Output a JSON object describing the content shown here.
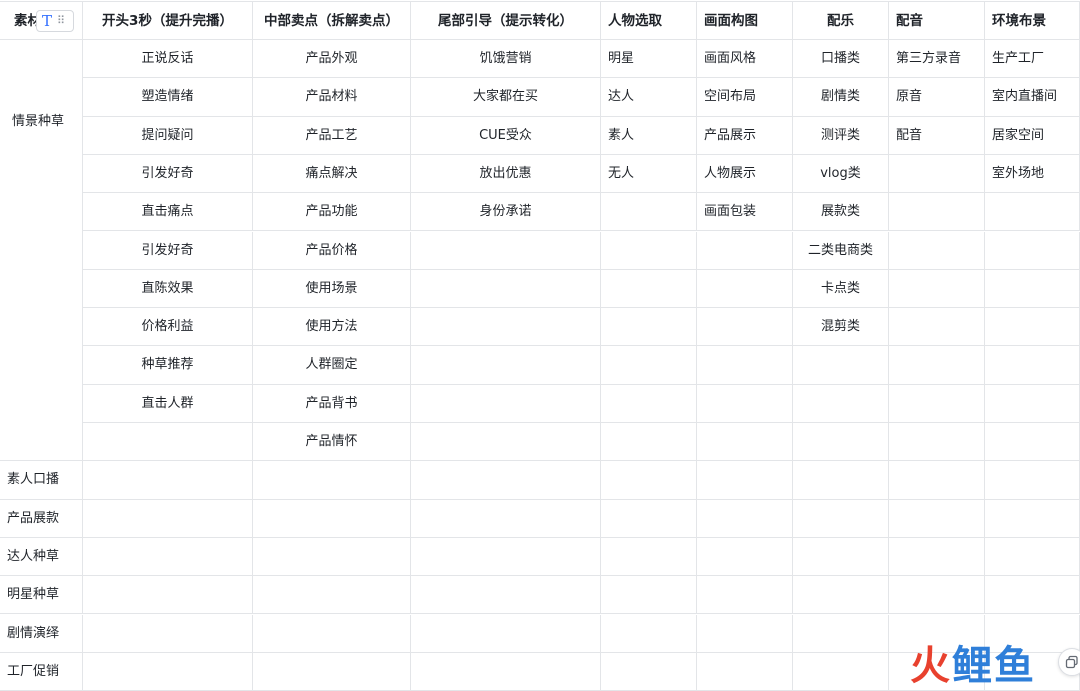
{
  "header": {
    "first_col": "素材",
    "columns": [
      "开头3秒（提升完播）",
      "中部卖点（拆解卖点）",
      "尾部引导（提示转化）",
      "人物选取",
      "画面构图",
      "配乐",
      "配音",
      "环境布景"
    ]
  },
  "categories": [
    "情景种草",
    "素人口播",
    "产品展款",
    "达人种草",
    "明星种草",
    "剧情演绎",
    "工厂促销"
  ],
  "columns": [
    [
      "正说反话",
      "塑造情绪",
      "提问疑问",
      "引发好奇",
      "直击痛点",
      "引发好奇",
      "直陈效果",
      "价格利益",
      "种草推荐",
      "直击人群"
    ],
    [
      "产品外观",
      "产品材料",
      "产品工艺",
      "痛点解决",
      "产品功能",
      "产品价格",
      "使用场景",
      "使用方法",
      "人群圈定",
      "产品背书",
      "产品情怀"
    ],
    [
      "饥饿营销",
      "大家都在买",
      "CUE受众",
      "放出优惠",
      "身份承诺"
    ],
    [
      "明星",
      "达人",
      "素人",
      "无人"
    ],
    [
      "画面风格",
      "空间布局",
      "产品展示",
      "人物展示",
      "画面包装"
    ],
    [
      "口播类",
      "剧情类",
      "测评类",
      "vlog类",
      "展款类",
      "二类电商类",
      "卡点类",
      "混剪类"
    ],
    [
      "第三方录音",
      "原音",
      "配音"
    ],
    [
      "生产工厂",
      "室内直播间",
      "居家空间",
      "室外场地"
    ]
  ],
  "watermark": {
    "huo": "火",
    "rest": "鲤鱼"
  },
  "icons": {
    "text_type": "T",
    "drag_handle": "⠿"
  },
  "colors": {
    "border": "#e3e5e8",
    "accent": "#3370ff",
    "watermark_red": "#e8412e",
    "watermark_blue": "#2f7fd9"
  }
}
